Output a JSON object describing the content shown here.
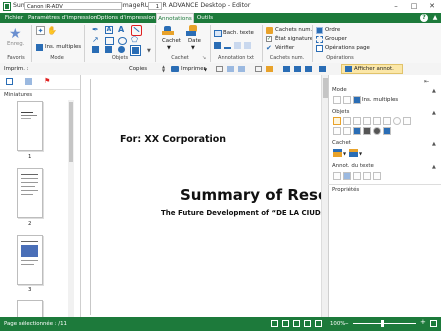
{
  "window": {
    "title": "Summary of Research.pdf - Canon imageRUNNER ADVANCE Desktop - Editor",
    "min_label": "–",
    "max_label": "□",
    "close_label": "✕"
  },
  "tabs": [
    "Fichier",
    "Paramètres d'impression",
    "Options d'impression",
    "Annotations",
    "Outils"
  ],
  "active_tab": "Annotations",
  "ribbon": {
    "favoris": {
      "enreg_label": "Enreg.",
      "group_label": "Favoris"
    },
    "mode": {
      "ins_multiples_label": "Ins. multiples",
      "group_label": "Mode"
    },
    "objets": {
      "group_label": "Objets"
    },
    "cachet": {
      "cachet_label": "Cachet",
      "date_label": "Date",
      "group_label": "Cachet"
    },
    "annotation_txt": {
      "bach_texte_label": "Bach. texte",
      "group_label": "Annotation txt"
    },
    "cachets_num": {
      "cachets_num_label": "Cachets num.",
      "etat_signature_label": "État signature",
      "verifier_label": "Vérifier",
      "group_label": "Cachets num."
    },
    "operations": {
      "ordre_label": "Ordre",
      "grouper_label": "Grouper",
      "operations_page_label": "Opérations page",
      "group_label": "Opérations"
    }
  },
  "toolbar": {
    "printer_label": "Imprim. :",
    "printer_value": "Canon iR-ADV",
    "copies_label": "Copies",
    "copies_value": "1",
    "imprimer_label": "Imprimer",
    "afficher_annot_label": "Afficher annot."
  },
  "left_panel": {
    "title": "Miniatures",
    "page_numbers": [
      "1",
      "2",
      "3"
    ]
  },
  "document": {
    "for_line": "For: XX Corporation",
    "main_title": "Summary of Resea",
    "subtitle": "The Future Development of “DE LA CIUDA"
  },
  "right_panel": {
    "mode_title": "Mode",
    "ins_multiples_label": "Ins. multiples",
    "objets_title": "Objets",
    "cachet_title": "Cachet",
    "annot_texte_title": "Annot. du texte",
    "proprietes_title": "Propriétés"
  },
  "status": {
    "page_selection": "Page sélectionnée : /11",
    "zoom": "100%"
  },
  "colors": {
    "brand_green": "#1d7a3b",
    "highlight_red": "#e02020",
    "tool_blue": "#2a6db5"
  }
}
